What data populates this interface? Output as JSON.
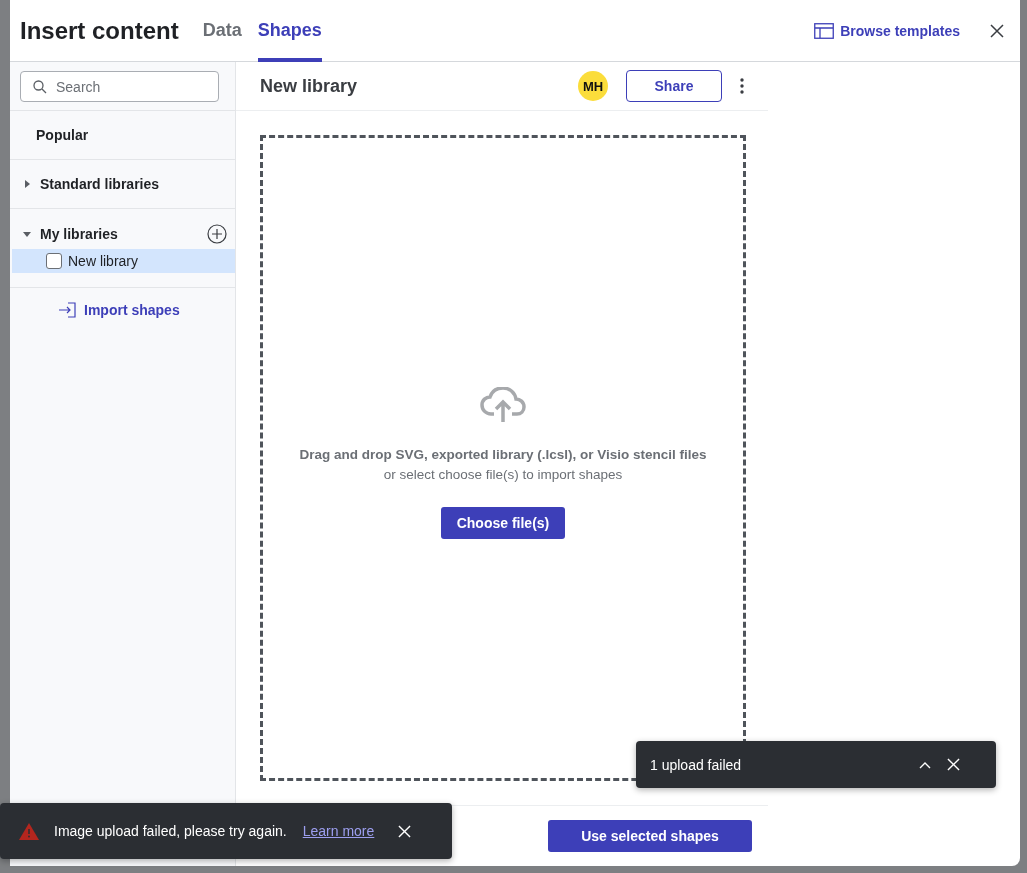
{
  "dialog": {
    "title": "Insert content"
  },
  "tabs": [
    {
      "label": "Data",
      "selected": false
    },
    {
      "label": "Shapes",
      "selected": true
    }
  ],
  "browse_templates": "Browse templates",
  "sidebar": {
    "search": {
      "placeholder": "Search"
    },
    "sections": [
      {
        "kind": "plain",
        "label": "Popular"
      },
      {
        "kind": "group",
        "label": "Standard libraries",
        "expanded": false,
        "addable": false
      },
      {
        "kind": "group",
        "label": "My libraries",
        "expanded": true,
        "addable": true,
        "children": [
          {
            "label": "New library",
            "checked": false,
            "selected": true
          }
        ]
      }
    ],
    "import_link": "Import shapes"
  },
  "library": {
    "title": "New library",
    "avatar": "MH",
    "share": "Share",
    "dropzone": {
      "heading": "Drag and drop SVG, exported library (.lcsl), or Visio stencil files",
      "subtext": "or select choose file(s) to import shapes",
      "button": "Choose file(s)"
    },
    "primary_button": "Use selected shapes"
  },
  "toasts": [
    {
      "kind": "error",
      "message": "Image upload failed, please try again.",
      "link": "Learn more"
    },
    {
      "kind": "status",
      "message": "1 upload failed"
    }
  ]
}
